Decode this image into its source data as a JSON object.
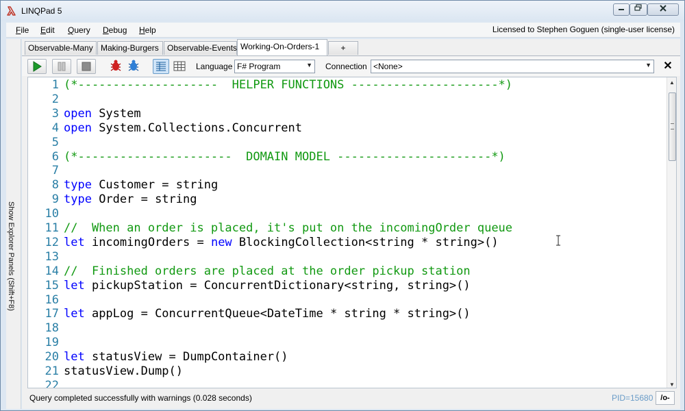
{
  "window": {
    "title": "LINQPad 5"
  },
  "menu": {
    "items": [
      {
        "label": "File",
        "key": "F"
      },
      {
        "label": "Edit",
        "key": "E"
      },
      {
        "label": "Query",
        "key": "Q"
      },
      {
        "label": "Debug",
        "key": "D"
      },
      {
        "label": "Help",
        "key": "H"
      }
    ],
    "license": "Licensed to Stephen Goguen (single-user license)"
  },
  "side_panel": {
    "label": "Show Explorer Panels  (Shift+F8)"
  },
  "tabs": [
    {
      "label": "Observable-Many",
      "active": false
    },
    {
      "label": "Making-Burgers",
      "active": false
    },
    {
      "label": "Observable-Events",
      "active": false
    },
    {
      "label": "Working-On-Orders-1",
      "active": true
    },
    {
      "label": "+",
      "active": false
    }
  ],
  "toolbar": {
    "language_label": "Language",
    "language_value": "F# Program",
    "connection_label": "Connection",
    "connection_value": "<None>",
    "close_label": "✕"
  },
  "editor": {
    "lines": [
      {
        "n": "1",
        "tokens": [
          {
            "t": "(*--------------------  HELPER FUNCTIONS ---------------------*)",
            "c": "cm"
          }
        ]
      },
      {
        "n": "2",
        "tokens": []
      },
      {
        "n": "3",
        "tokens": [
          {
            "t": "open",
            "c": "kw"
          },
          {
            "t": " System",
            "c": ""
          }
        ]
      },
      {
        "n": "4",
        "tokens": [
          {
            "t": "open",
            "c": "kw"
          },
          {
            "t": " System.Collections.Concurrent",
            "c": ""
          }
        ]
      },
      {
        "n": "5",
        "tokens": []
      },
      {
        "n": "6",
        "tokens": [
          {
            "t": "(*----------------------  DOMAIN MODEL ----------------------*)",
            "c": "cm"
          }
        ]
      },
      {
        "n": "7",
        "tokens": []
      },
      {
        "n": "8",
        "tokens": [
          {
            "t": "type",
            "c": "kw"
          },
          {
            "t": " Customer = string",
            "c": ""
          }
        ]
      },
      {
        "n": "9",
        "tokens": [
          {
            "t": "type",
            "c": "kw"
          },
          {
            "t": " Order = string",
            "c": ""
          }
        ]
      },
      {
        "n": "10",
        "tokens": []
      },
      {
        "n": "11",
        "tokens": [
          {
            "t": "//  When an order is placed, it's put on the incomingOrder queue",
            "c": "cm"
          }
        ]
      },
      {
        "n": "12",
        "tokens": [
          {
            "t": "let",
            "c": "kw"
          },
          {
            "t": " incomingOrders = ",
            "c": ""
          },
          {
            "t": "new",
            "c": "kw"
          },
          {
            "t": " BlockingCollection<string * string>()",
            "c": ""
          }
        ]
      },
      {
        "n": "13",
        "tokens": []
      },
      {
        "n": "14",
        "tokens": [
          {
            "t": "//  Finished orders are placed at the order pickup station",
            "c": "cm"
          }
        ]
      },
      {
        "n": "15",
        "tokens": [
          {
            "t": "let",
            "c": "kw"
          },
          {
            "t": " pickupStation = ConcurrentDictionary<string, string>()",
            "c": ""
          }
        ]
      },
      {
        "n": "16",
        "tokens": []
      },
      {
        "n": "17",
        "tokens": [
          {
            "t": "let",
            "c": "kw"
          },
          {
            "t": " appLog = ConcurrentQueue<DateTime * string * string>()",
            "c": ""
          }
        ]
      },
      {
        "n": "18",
        "tokens": []
      },
      {
        "n": "19",
        "tokens": []
      },
      {
        "n": "20",
        "tokens": [
          {
            "t": "let",
            "c": "kw"
          },
          {
            "t": " statusView = DumpContainer()",
            "c": ""
          }
        ]
      },
      {
        "n": "21",
        "tokens": [
          {
            "t": "statusView.Dump()",
            "c": ""
          }
        ]
      },
      {
        "n": "22",
        "tokens": []
      }
    ]
  },
  "status": {
    "message": "Query completed successfully with warnings  (0.028 seconds)",
    "pid": "PID=15680",
    "results_toggle": "/o-"
  },
  "colors": {
    "keyword": "#0000ff",
    "comment": "#119911",
    "line_number": "#2a7fa6",
    "pid": "#6a9cc8"
  },
  "icons": {
    "app": "linqpad-lambda-icon",
    "run": "play-icon",
    "pause": "pause-icon",
    "stop": "stop-icon",
    "debug_red": "bug-icon",
    "debug_blue": "bug-icon",
    "results_rich": "grid-rich-icon",
    "results_grid": "grid-icon"
  }
}
